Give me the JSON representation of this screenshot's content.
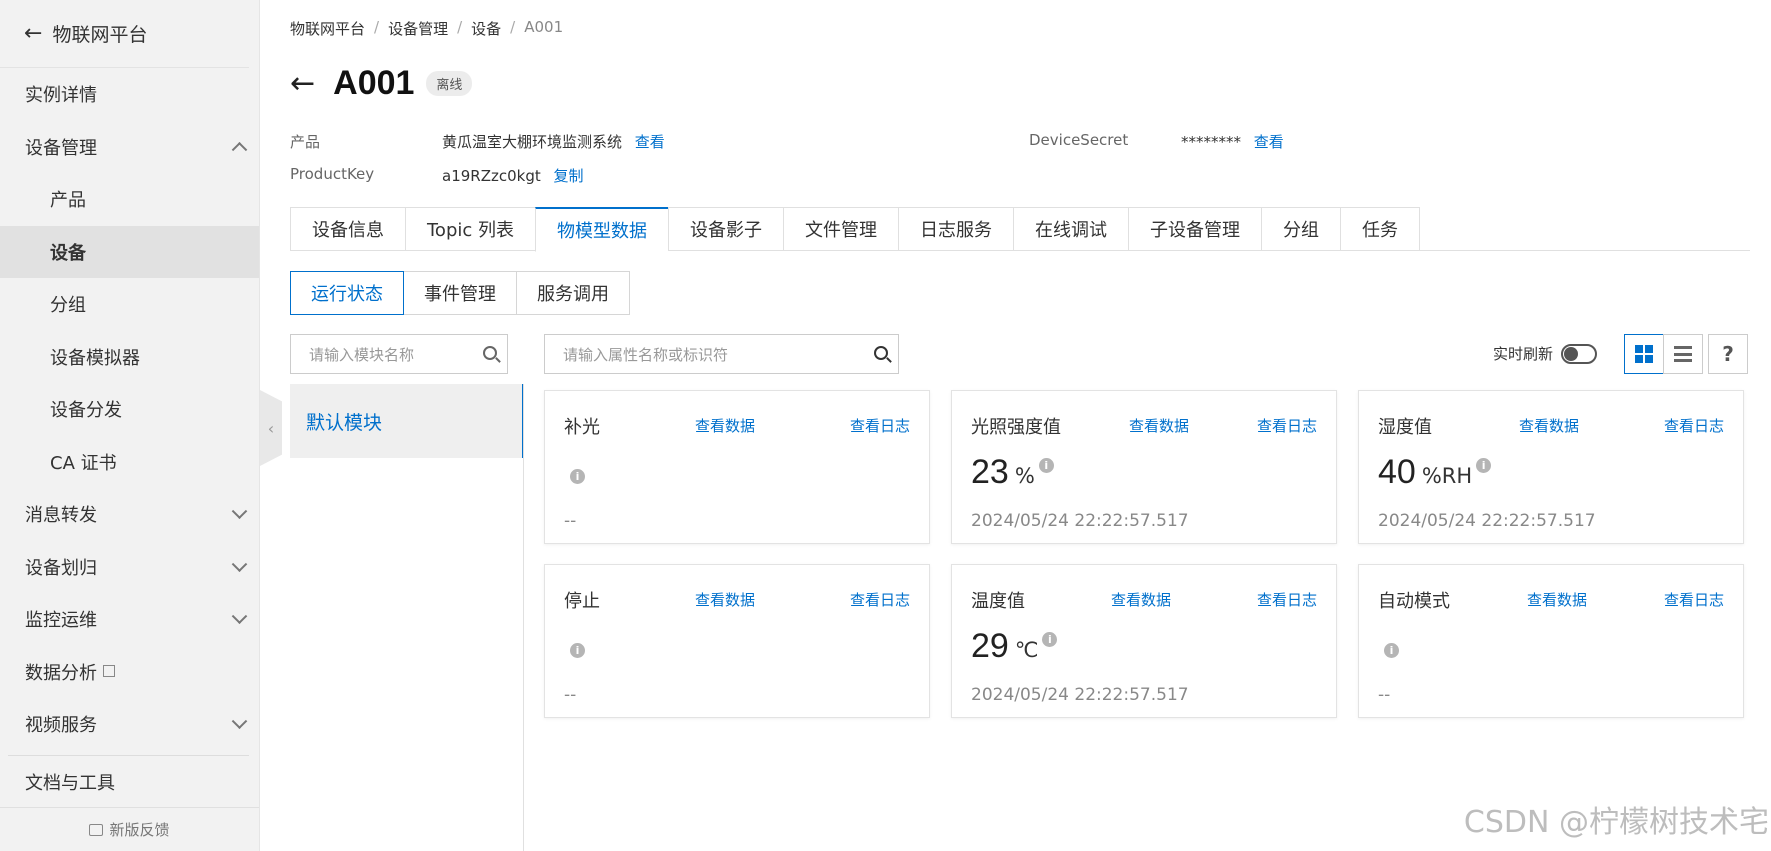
{
  "sidebar": {
    "header": "物联网平台",
    "items": [
      {
        "label": "实例详情"
      },
      {
        "label": "设备管理"
      },
      {
        "label": "产品"
      },
      {
        "label": "设备"
      },
      {
        "label": "分组"
      },
      {
        "label": "设备模拟器"
      },
      {
        "label": "设备分发"
      },
      {
        "label": "CA 证书"
      },
      {
        "label": "消息转发"
      },
      {
        "label": "设备划归"
      },
      {
        "label": "监控运维"
      },
      {
        "label": "数据分析"
      },
      {
        "label": "视频服务"
      },
      {
        "label": "文档与工具"
      }
    ],
    "footer": "新版反馈"
  },
  "breadcrumb": [
    "物联网平台",
    "设备管理",
    "设备",
    "A001"
  ],
  "device": {
    "name": "A001",
    "status": "离线",
    "product_label": "产品",
    "product_value": "黄瓜温室大棚环境监测系统",
    "product_link": "查看",
    "productkey_label": "ProductKey",
    "productkey_value": "a19RZzc0kgt",
    "productkey_link": "复制",
    "secret_label": "DeviceSecret",
    "secret_value": "********",
    "secret_link": "查看"
  },
  "tabs": [
    "设备信息",
    "Topic 列表",
    "物模型数据",
    "设备影子",
    "文件管理",
    "日志服务",
    "在线调试",
    "子设备管理",
    "分组",
    "任务"
  ],
  "subtabs": [
    "运行状态",
    "事件管理",
    "服务调用"
  ],
  "module": {
    "search_placeholder": "请输入模块名称",
    "items": [
      "默认模块"
    ]
  },
  "property": {
    "search_placeholder": "请输入属性名称或标识符",
    "realtime_label": "实时刷新",
    "realtime_on": false
  },
  "cards": [
    {
      "name": "补光",
      "link_data": "查看数据",
      "link_log": "查看日志",
      "value": "",
      "unit": "",
      "time": "--"
    },
    {
      "name": "光照强度值",
      "link_data": "查看数据",
      "link_log": "查看日志",
      "value": "23",
      "unit": "%",
      "time": "2024/05/24 22:22:57.517"
    },
    {
      "name": "湿度值",
      "link_data": "查看数据",
      "link_log": "查看日志",
      "value": "40",
      "unit": "%RH",
      "time": "2024/05/24 22:22:57.517"
    },
    {
      "name": "停止",
      "link_data": "查看数据",
      "link_log": "查看日志",
      "value": "",
      "unit": "",
      "time": "--"
    },
    {
      "name": "温度值",
      "link_data": "查看数据",
      "link_log": "查看日志",
      "value": "29",
      "unit": "℃",
      "time": "2024/05/24 22:22:57.517"
    },
    {
      "name": "自动模式",
      "link_data": "查看数据",
      "link_log": "查看日志",
      "value": "",
      "unit": "",
      "time": "--"
    }
  ],
  "watermark": "CSDN @柠檬树技术宅",
  "colors": {
    "accent": "#0070cc",
    "sidebar_bg": "#f2f2f2"
  }
}
